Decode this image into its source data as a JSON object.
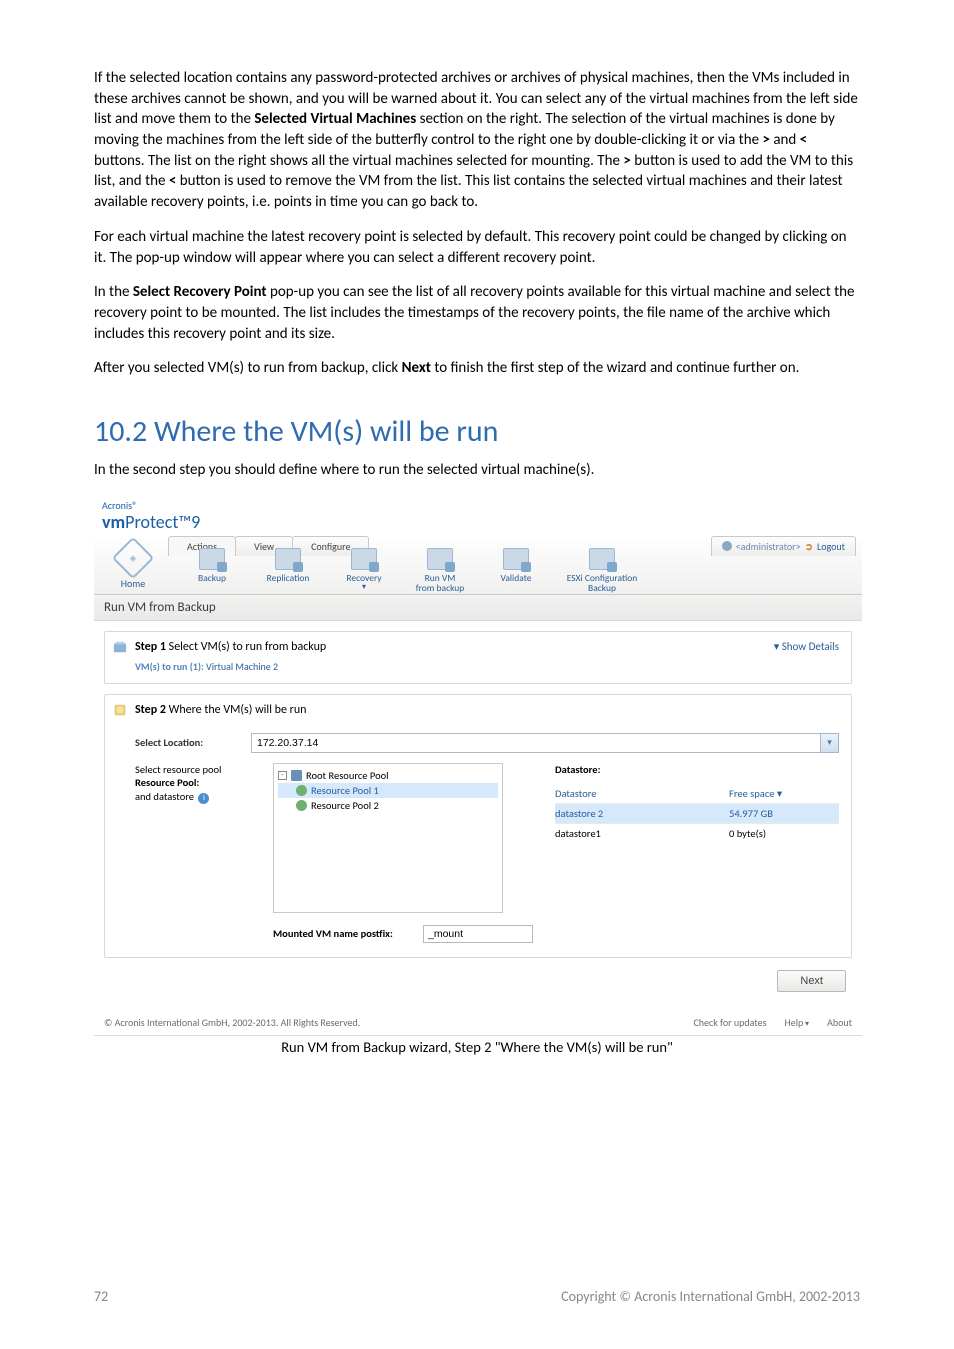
{
  "paragraphs": {
    "p1_a": "If the selected location contains any password-protected archives or archives of physical machines, then the VMs included in these archives cannot be shown, and you will be warned about it. You can select any of the virtual machines from the left side list and move them to the ",
    "p1_b_bold": "Selected Virtual Machines",
    "p1_c": " section on the right. The selection of the virtual machines is done by moving the machines from the left side of the butterfly control to the right one by double-clicking it or via the ",
    "gt": ">",
    "p1_d": " and ",
    "lt": "<",
    "p1_e": " buttons. The list on the right shows all the virtual machines selected for mounting. The ",
    "p1_f": " button is used to add the VM to this list, and the ",
    "p1_g": " button is used to remove the VM from the list. This list contains the selected virtual machines and their latest available recovery points, i.e. points in time you can go back to.",
    "p2": "For each virtual machine the latest recovery point is selected by default. This recovery point could be changed by clicking on it. The pop-up window will appear where you can select a different recovery point.",
    "p3_a": "In the ",
    "p3_bold": "Select Recovery Point",
    "p3_b": " pop-up you can see the list of all recovery points available for this virtual machine and select the recovery point to be mounted. The list includes the timestamps of the recovery points, the file name of the archive which includes this recovery point and its size.",
    "p4_a": "After you selected VM(s) to run from backup, click ",
    "p4_bold": "Next",
    "p4_b": " to finish the first step of the wizard and continue further on."
  },
  "section_heading": "10.2  Where the VM(s) will be run",
  "section_intro": "In the second step you should define where to run the selected virtual machine(s).",
  "screenshot": {
    "brand_top": "Acronis®",
    "brand_vm": "vm",
    "brand_protect": "Protect™9",
    "tabs": [
      "Actions",
      "View",
      "Configure"
    ],
    "user_label": "<administrator>",
    "logout": "Logout",
    "home": "Home",
    "toolbar": [
      "Backup",
      "Replication",
      "Recovery",
      "Run VM\nfrom backup",
      "Validate",
      "ESXi Configuration\nBackup"
    ],
    "page_title": "Run VM from Backup",
    "step1_title_a": "Step 1",
    "step1_title_b": " Select VM(s) to run from backup",
    "show_details": "Show Details",
    "step1_sub_a": "VM(s) to run (1): ",
    "step1_sub_b": "Virtual Machine 2",
    "step2_title_a": "Step 2",
    "step2_title_b": " Where the VM(s) will be run",
    "select_location_label": "Select Location:",
    "select_location_value": "172.20.37.14",
    "resource_label_a": "Select resource pool",
    "resource_label_b": "Resource Pool:",
    "resource_label_c": "and datastore",
    "tree": {
      "root": "Root Resource Pool",
      "rp1": "Resource Pool 1",
      "rp2": "Resource Pool 2"
    },
    "datastore_title": "Datastore:",
    "ds_head_c1": "Datastore",
    "ds_head_c2": "Free space ▾",
    "ds_rows": [
      {
        "c1": "datastore 2",
        "c2": "54.977 GB"
      },
      {
        "c1": "datastore1",
        "c2": "0 byte(s)"
      }
    ],
    "mount_label": "Mounted VM name postfix:",
    "mount_value": "_mount",
    "next": "Next",
    "footer_left": "© Acronis International GmbH, 2002-2013. All Rights Reserved.",
    "footer_check": "Check for updates",
    "footer_help": "Help",
    "footer_about": "About"
  },
  "caption": "Run VM from Backup wizard, Step 2 \"Where the VM(s) will be run\"",
  "page_footer": {
    "num": "72",
    "copy": "Copyright © Acronis International GmbH, 2002-2013"
  }
}
